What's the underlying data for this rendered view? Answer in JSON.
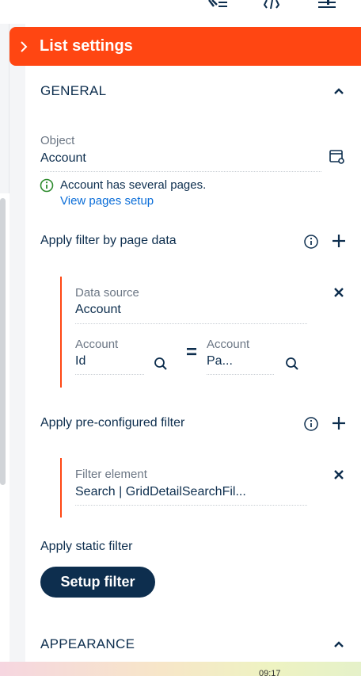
{
  "header": {
    "title": "List settings"
  },
  "general": {
    "heading": "GENERAL",
    "object": {
      "label": "Object",
      "value": "Account"
    },
    "notice": "Account has several pages.",
    "notice_link": "View pages setup",
    "page_filter": {
      "title": "Apply filter by page data",
      "data_source": {
        "label": "Data source",
        "value": "Account"
      },
      "left": {
        "label": "Account",
        "value": "Id"
      },
      "operator": "=",
      "right": {
        "label": "Account",
        "value": "Pa..."
      }
    },
    "preconfigured_filter": {
      "title": "Apply pre-configured filter",
      "filter_element": {
        "label": "Filter element",
        "value": "Search | GridDetailSearchFil..."
      }
    },
    "static_filter": {
      "title": "Apply static filter",
      "button_label": "Setup filter"
    }
  },
  "appearance": {
    "heading": "APPEARANCE"
  },
  "taskbar": {
    "clock": "09:17"
  },
  "colors": {
    "accent": "#ff4612",
    "navy": "#0d2e4e",
    "link": "#0a6dd8"
  }
}
